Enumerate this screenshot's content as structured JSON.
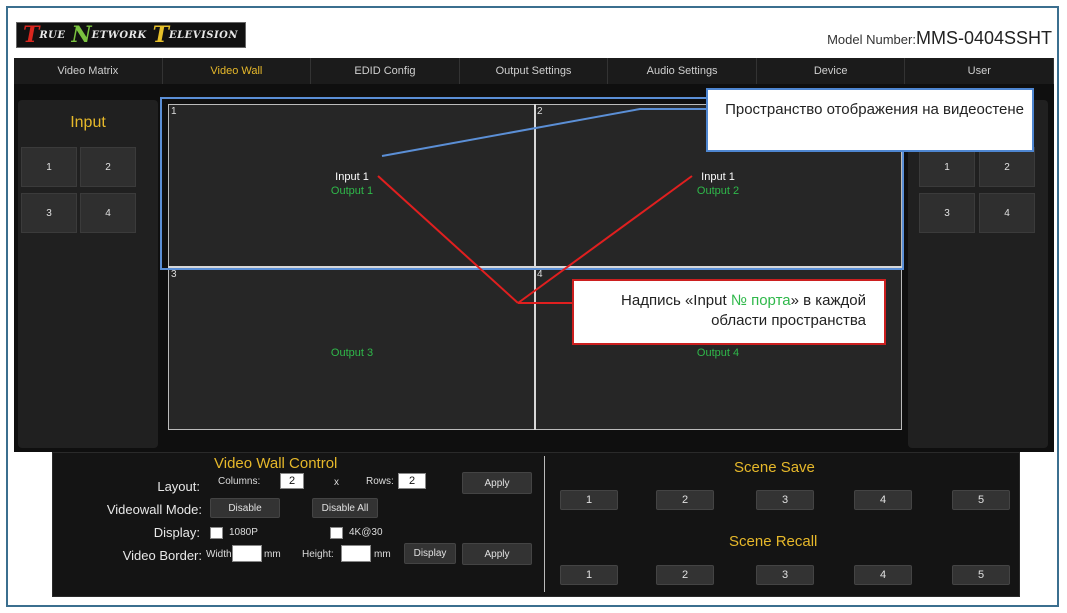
{
  "header": {
    "logo": [
      {
        "initial": "T",
        "rest": "RUE",
        "color": "#d8261e"
      },
      {
        "initial": "N",
        "rest": "ETWORK",
        "color": "#7ac23f"
      },
      {
        "initial": "T",
        "rest": "ELEVISION",
        "color": "#e6c02a"
      }
    ],
    "model_label": "Model Number:",
    "model_number": "MMS-0404SSHT"
  },
  "nav": [
    "Video Matrix",
    "Video Wall",
    "EDID Config",
    "Output Settings",
    "Audio Settings",
    "Device",
    "User"
  ],
  "nav_active": "Video Wall",
  "input_panel": {
    "title": "Input",
    "buttons": [
      "1",
      "2",
      "3",
      "4"
    ]
  },
  "output_panel": {
    "buttons": [
      "1",
      "2",
      "3",
      "4"
    ]
  },
  "wall": {
    "cells": [
      {
        "num": "1",
        "input": "Input 1",
        "output": "Output 1"
      },
      {
        "num": "2",
        "input": "Input 1",
        "output": "Output 2"
      },
      {
        "num": "3",
        "input": "",
        "output": "Output 3"
      },
      {
        "num": "4",
        "input": "",
        "output": "Output 4"
      }
    ]
  },
  "callouts": {
    "display_space": "Пространство отображения на видеостене",
    "label_pre": "Надпись «Input ",
    "label_port": "№ порта",
    "label_post": "» в каждой области пространства"
  },
  "control": {
    "title": "Video Wall Control",
    "layout_label": "Layout:",
    "columns_label": "Columns:",
    "columns_value": "2",
    "x_label": "x",
    "rows_label": "Rows:",
    "rows_value": "2",
    "apply": "Apply",
    "mode_label": "Videowall Mode:",
    "disable": "Disable",
    "disable_all": "Disable All",
    "display_label": "Display:",
    "opt_1080p": "1080P",
    "opt_4k": "4K@30",
    "border_label": "Video Border:",
    "width_label": "Width:",
    "mm1": "mm",
    "height_label": "Height:",
    "mm2": "mm",
    "display_btn": "Display",
    "apply2": "Apply"
  },
  "scene_save": {
    "title": "Scene Save",
    "buttons": [
      "1",
      "2",
      "3",
      "4",
      "5"
    ]
  },
  "scene_recall": {
    "title": "Scene Recall",
    "buttons": [
      "1",
      "2",
      "3",
      "4",
      "5"
    ]
  },
  "colors": {
    "accent": "#e6b82a",
    "output_text": "#2fb84a",
    "callout_blue": "#4e86d1",
    "callout_red": "#cc1f1f"
  }
}
